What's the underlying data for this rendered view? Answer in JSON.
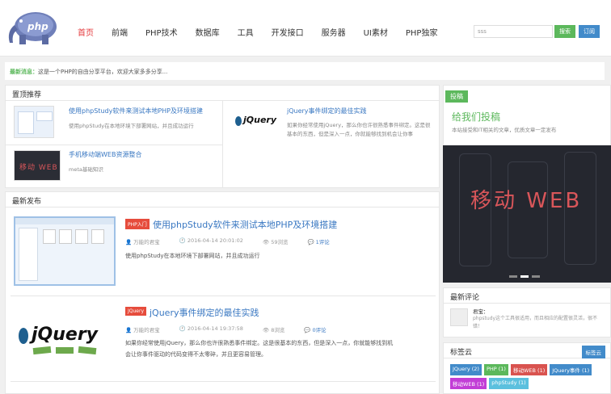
{
  "header": {
    "nav": [
      "首页",
      "前端",
      "PHP技术",
      "数据库",
      "工具",
      "开发接口",
      "服务器",
      "UI素材",
      "PHP独家"
    ],
    "search_placeholder": "sss",
    "search_btn": "搜索",
    "subscribe_btn": "订阅",
    "logo_text": "php"
  },
  "notice": {
    "label": "最新消息：",
    "text": "这是一个PHP的自由分享平台，欢迎大家多多分享..."
  },
  "top": {
    "title": "置顶推荐",
    "items": [
      {
        "title": "使用phpStudy软件来测试本地PHP及环境搭建",
        "desc": "使用phpStudy在本地环境下部署网站，并且成功运行"
      },
      {
        "title": "jQuery事件绑定的最佳实践",
        "desc": "如果你经常使用jQuery，那么你也许很熟悉事件绑定。这是很基本的东西，但是深入一点，你就能够找到机会让你事"
      },
      {
        "title": "手机移动端WEB资源整合",
        "desc": "meta基础知识"
      }
    ],
    "thumb_text": "移动 WEB"
  },
  "latest": {
    "title": "最新发布",
    "articles": [
      {
        "tag": "PHP入门",
        "tag_color": "#e64c3c",
        "title": "使用phpStudy软件来测试本地PHP及环境搭建",
        "author": "万能的君宝",
        "date": "2016-04-14 20:01:02",
        "views": "59浏览",
        "comments": "1评论",
        "desc": "使用phpStudy在本地环境下部署网站，并且成功运行"
      },
      {
        "tag": "JQuery",
        "tag_color": "#e64c3c",
        "title": "jQuery事件绑定的最佳实践",
        "author": "万能的君宝",
        "date": "2016-04-14 19:37:58",
        "views": "8浏览",
        "comments": "0评论",
        "desc1": "如果你经常使用jQuery，那么你也许很熟悉事件绑定。这是很基本的东西，但是深入一点，你就能够找到机",
        "desc2": "会让你事件驱动的代码变得不太零碎，并且更容易管理。"
      }
    ]
  },
  "sidebar": {
    "contrib_badge": "投稿",
    "contrib_title": "给我们投稿",
    "contrib_desc": "本站接受和IT相关的文章，优质文章一定发布",
    "slider_text": "移动 WEB",
    "comments_title": "最新评论",
    "comment_name": "君宝：",
    "comment_text": "phpstudy这个工具很适用，而且相应的配置很灵活，很不错！",
    "tags_title": "标签云",
    "tags_btn": "标签云",
    "tags": [
      {
        "label": "JQuery (2)",
        "color": "#428bca"
      },
      {
        "label": "PHP (1)",
        "color": "#5cb85c"
      },
      {
        "label": "移动WEB (1)",
        "color": "#d9534f"
      },
      {
        "label": "JQuery事件 (1)",
        "color": "#428bca"
      },
      {
        "label": "移动WEB (1)",
        "color": "#c23dd6"
      },
      {
        "label": "phpStudy (1)",
        "color": "#5bc0de"
      }
    ]
  }
}
